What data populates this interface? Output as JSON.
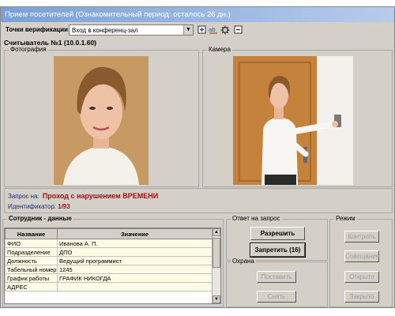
{
  "window": {
    "title": "Прием посетителей (Ознакомительный период: осталось 26 дн.)"
  },
  "toolbar": {
    "label": "Точки верификации :",
    "selected_point": "Вход в конференц-зал",
    "icons": [
      "add-icon",
      "rename-icon",
      "settings-icon",
      "delete-icon"
    ]
  },
  "reader": {
    "title": "Считыватель №1 (10.0.1.60)"
  },
  "photo_panel": {
    "label": "Фотография"
  },
  "camera_panel": {
    "label": "Камера"
  },
  "request": {
    "label": "Запрос на:",
    "text": "Проход с нарушением ВРЕМЕНИ",
    "id_label": "Идентификатор:",
    "id_value": "1/93"
  },
  "employee": {
    "label": "Сотрудник - данные",
    "headers": [
      "Название",
      "Значение"
    ],
    "rows": [
      [
        "ФИО",
        "Иванова А. П."
      ],
      [
        "Подразделение",
        "ДПО"
      ],
      [
        "Должность",
        "Ведущий программист"
      ],
      [
        "Табельный номер",
        "1245"
      ],
      [
        "График работы",
        "ГРАФИК НИКОГДА"
      ],
      [
        "АДРЕС",
        ""
      ]
    ]
  },
  "answer": {
    "label": "Ответ на запрос",
    "allow": "Разрешить",
    "deny": "Запретить (16)"
  },
  "guard": {
    "label": "Охрана",
    "arm": "Поставить",
    "disarm": "Снять"
  },
  "mode": {
    "label": "Режим",
    "buttons": [
      "Контроль",
      "Совещание",
      "Открыто",
      "Закрыто"
    ]
  },
  "colors": {
    "title_start": "#7aa0d6",
    "title_end": "#b7ccec",
    "alert_red": "#9b1212",
    "label_blue": "#1c2f7a"
  }
}
